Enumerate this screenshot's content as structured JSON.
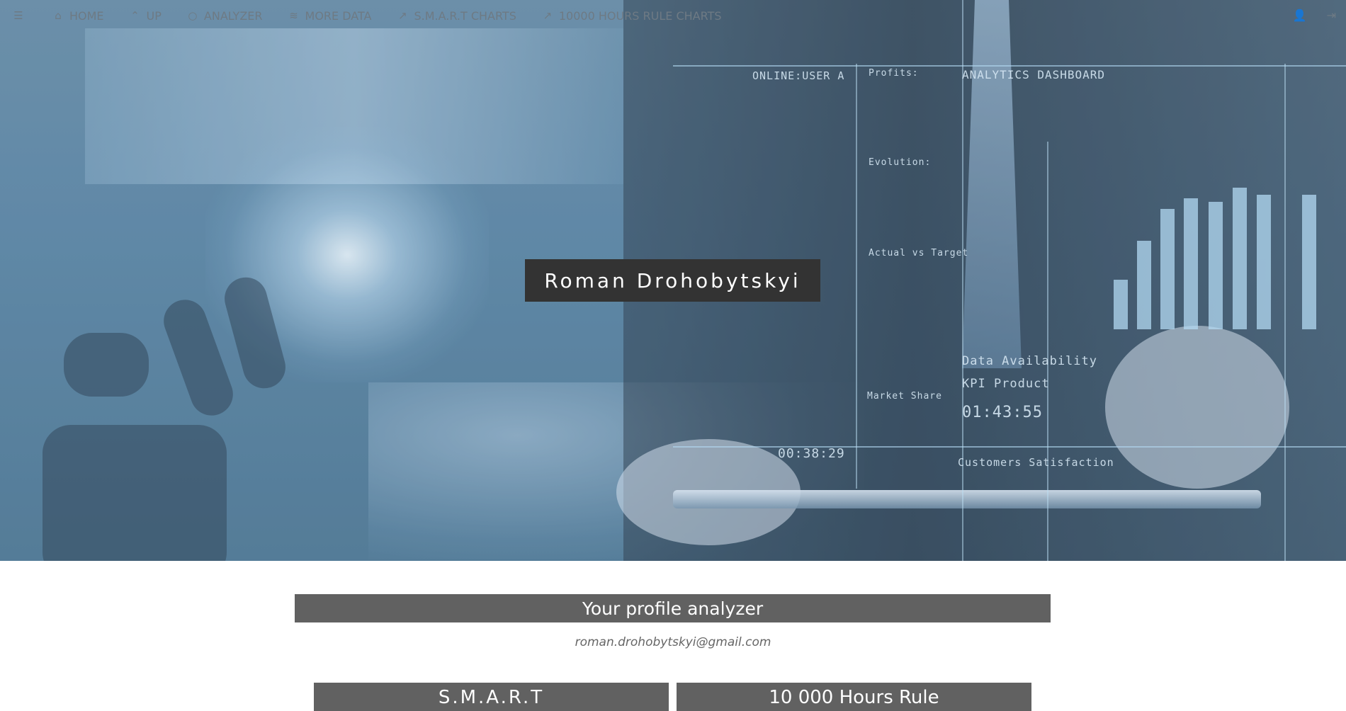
{
  "nav": {
    "items": [
      {
        "label": "HOME",
        "icon": "home-icon"
      },
      {
        "label": "UP",
        "icon": "chevron-up-icon"
      },
      {
        "label": "ANALYZER",
        "icon": "circle-icon"
      },
      {
        "label": "MORE DATA",
        "icon": "database-icon"
      },
      {
        "label": "S.M.A.R.T CHARTS",
        "icon": "chart-icon"
      },
      {
        "label": "10000 HOURS RULE CHARTS",
        "icon": "chart-icon"
      }
    ],
    "right_icons": [
      "user-icon",
      "sign-in-icon"
    ]
  },
  "hero": {
    "name": "Roman Drohobytskyi",
    "hud": {
      "online": "ONLINE:USER A",
      "profits": "Profits:",
      "dashboard": "ANALYTICS DASHBOARD",
      "evolution": "Evolution:",
      "actual_vs_target": "Actual vs Target",
      "data_availability": "Data Availability",
      "kpi": "KPI Product",
      "market_share": "Market Share",
      "time_code": "00:38:29",
      "clock": "01:43:55",
      "customers": "Customers Satisfaction"
    }
  },
  "profile": {
    "title": "Your profile analyzer",
    "email": "roman.drohobytskyi@gmail.com"
  },
  "cards": {
    "smart": "S.M.A.R.T",
    "hours": "10 000 Hours Rule"
  }
}
